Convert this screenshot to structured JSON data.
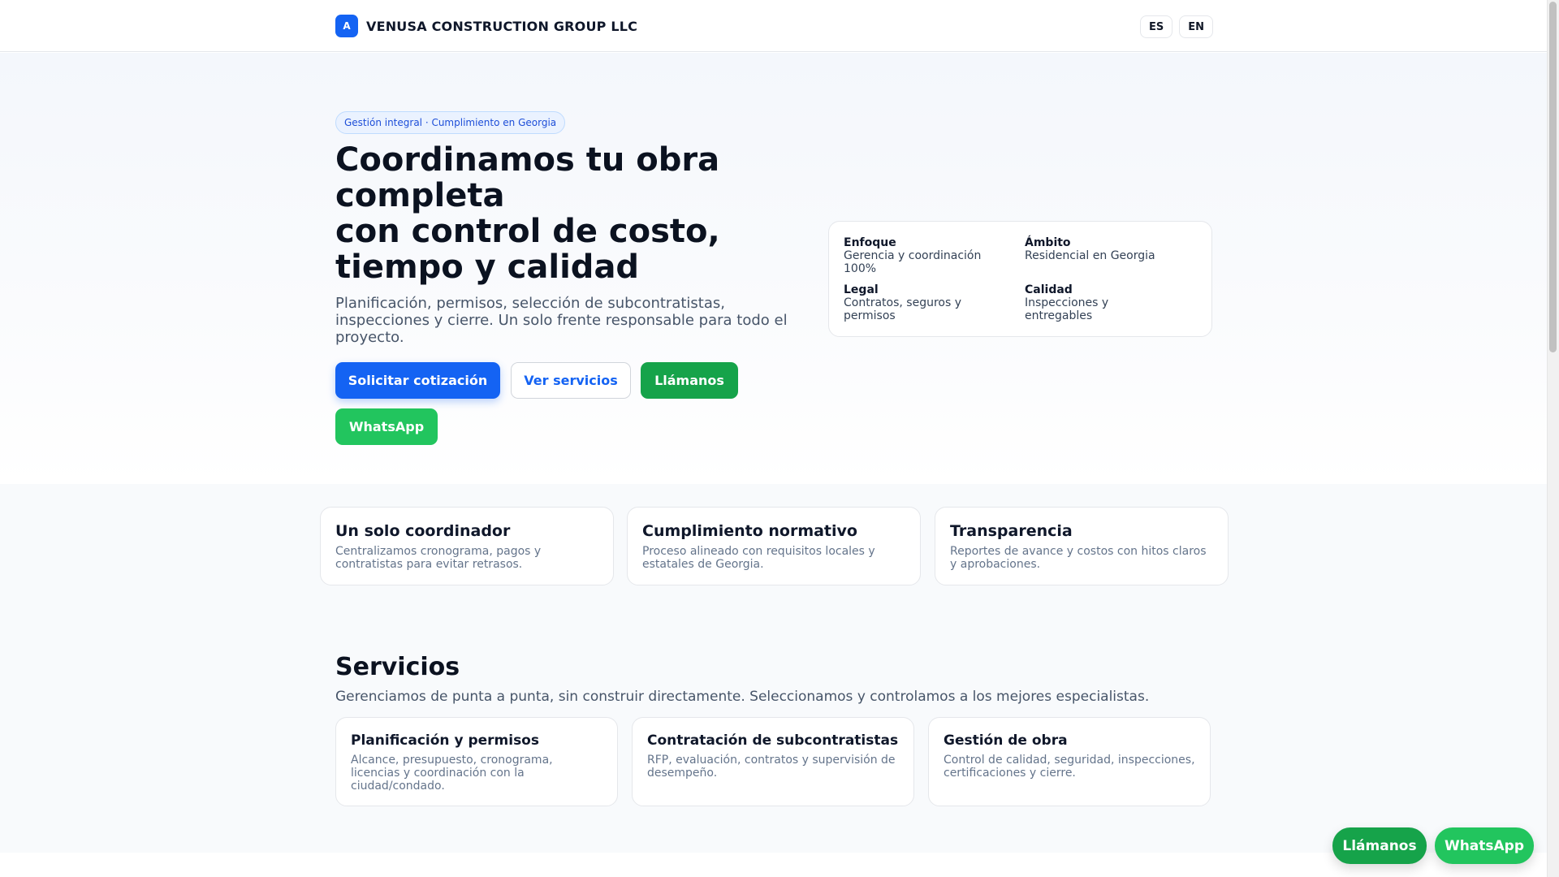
{
  "header": {
    "logo_letter": "A",
    "brand_name": "VENUSA CONSTRUCTION GROUP LLC",
    "languages": [
      "ES",
      "EN"
    ]
  },
  "hero": {
    "eyebrow": "Gestión integral · Cumplimiento en Georgia",
    "title_lines": [
      "Coordinamos tu obra",
      "completa",
      "con control de costo,",
      "tiempo y calidad"
    ],
    "subtitle": "Planificación, permisos, selección de subcontratistas, inspecciones y cierre. Un solo frente responsable para todo el proyecto.",
    "buttons": {
      "quote": "Solicitar cotización",
      "services": "Ver servicios",
      "call": "Llámanos",
      "whatsapp": "WhatsApp"
    },
    "info": [
      {
        "label": "Enfoque",
        "value": "Gerencia y coordinación 100%"
      },
      {
        "label": "Ámbito",
        "value": "Residencial en Georgia"
      },
      {
        "label": "Legal",
        "value": "Contratos, seguros y permisos"
      },
      {
        "label": "Calidad",
        "value": "Inspecciones y entregables"
      }
    ]
  },
  "features": [
    {
      "title": "Un solo coordinador",
      "text": "Centralizamos cronograma, pagos y contratistas para evitar retrasos."
    },
    {
      "title": "Cumplimiento normativo",
      "text": "Proceso alineado con requisitos locales y estatales de Georgia."
    },
    {
      "title": "Transparencia",
      "text": "Reportes de avance y costos con hitos claros y aprobaciones."
    }
  ],
  "services": {
    "title": "Servicios",
    "subtitle": "Gerenciamos de punta a punta, sin construir directamente. Seleccionamos y controlamos a los mejores especialistas.",
    "items": [
      {
        "title": "Planificación y permisos",
        "text": "Alcance, presupuesto, cronograma, licencias y coordinación con la ciudad/condado."
      },
      {
        "title": "Contratación de subcontratistas",
        "text": "RFP, evaluación, contratos y supervisión de desempeño."
      },
      {
        "title": "Gestión de obra",
        "text": "Control de calidad, seguridad, inspecciones, certificaciones y cierre."
      }
    ]
  },
  "floating": {
    "call": "Llámanos",
    "whatsapp": "WhatsApp"
  },
  "colors": {
    "primary": "#1463f3",
    "green": "#16a34a",
    "whatsapp": "#22c55e"
  }
}
